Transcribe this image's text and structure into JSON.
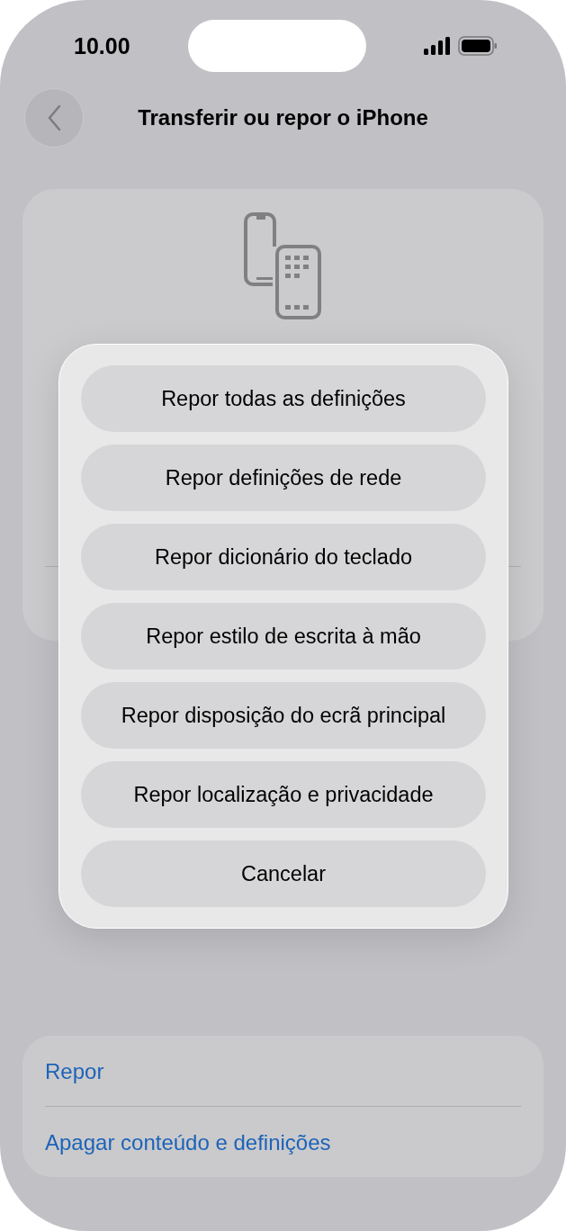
{
  "status_bar": {
    "time": "10.00"
  },
  "nav": {
    "title": "Transferir ou repor o iPhone"
  },
  "action_sheet": {
    "options": [
      {
        "label": "Repor todas as definições"
      },
      {
        "label": "Repor definições de rede"
      },
      {
        "label": "Repor dicionário do teclado"
      },
      {
        "label": "Repor estilo de escrita à mão"
      },
      {
        "label": "Repor disposição do ecrã principal"
      },
      {
        "label": "Repor localização e privacidade"
      },
      {
        "label": "Cancelar"
      }
    ]
  },
  "settings_list": {
    "items": [
      {
        "label": "Repor"
      },
      {
        "label": "Apagar conteúdo e definições"
      }
    ]
  }
}
